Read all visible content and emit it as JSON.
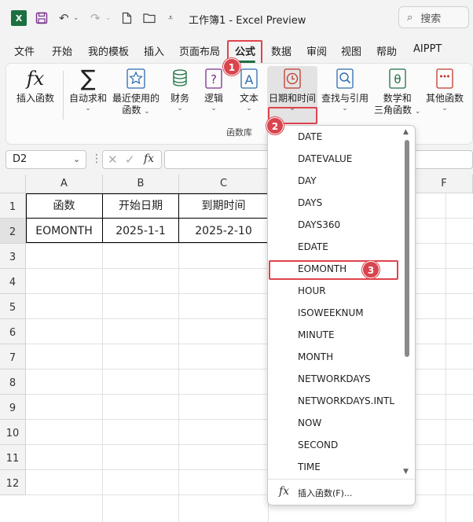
{
  "titlebar": {
    "doc_title": "工作簿1  -  Excel Preview",
    "search_placeholder": "搜索",
    "app_icon_letter": "X"
  },
  "tabs": [
    "文件",
    "开始",
    "我的模板",
    "插入",
    "页面布局",
    "公式",
    "数据",
    "审阅",
    "视图",
    "帮助",
    "AIPPT"
  ],
  "active_tab": "公式",
  "ribbon": {
    "insert_function": "插入函数",
    "autosum": "自动求和",
    "recently_used": [
      "最近使用的",
      "函数"
    ],
    "financial": "财务",
    "logical": "逻辑",
    "text": "文本",
    "date_time": "日期和时间",
    "lookup": "查找与引用",
    "math_trig": [
      "数学和",
      "三角函数"
    ],
    "more_functions": "其他函数",
    "group_label": "函数库"
  },
  "formula_bar": {
    "name_box": "D2",
    "fx_label": "fx",
    "formula": ""
  },
  "grid": {
    "columns": [
      "A",
      "B",
      "C",
      "F"
    ],
    "rows": [
      "1",
      "2",
      "3",
      "4",
      "5",
      "6",
      "7",
      "8",
      "9",
      "10",
      "11",
      "12"
    ],
    "header_row": [
      "函数",
      "开始日期",
      "到期时间"
    ],
    "data_row": [
      "EOMONTH",
      "2025-1-1",
      "2025-2-10"
    ]
  },
  "dropdown": {
    "items": [
      "DATE",
      "DATEVALUE",
      "DAY",
      "DAYS",
      "DAYS360",
      "EDATE",
      "EOMONTH",
      "HOUR",
      "ISOWEEKNUM",
      "MINUTE",
      "MONTH",
      "NETWORKDAYS",
      "NETWORKDAYS.INTL",
      "NOW",
      "SECOND",
      "TIME"
    ],
    "selected": "EOMONTH",
    "footer_label": "插入函数(F)..."
  },
  "steps": [
    "1",
    "2",
    "3"
  ],
  "colors": {
    "accent_green": "#1d6f42",
    "highlight_red": "#e0434f",
    "badge_red": "#d9454f"
  }
}
